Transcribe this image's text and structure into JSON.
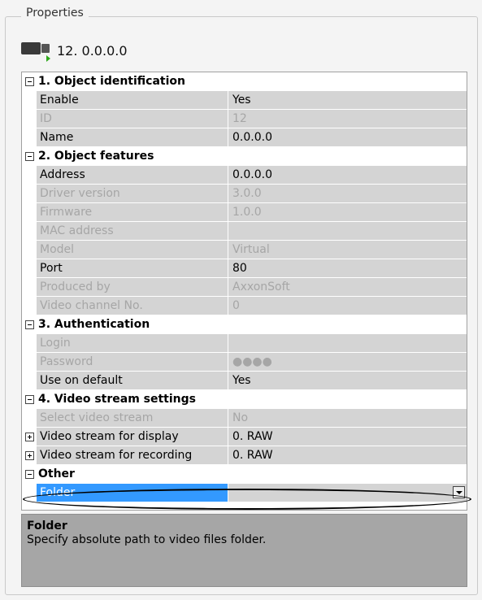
{
  "panel": {
    "legend": "Properties"
  },
  "header": {
    "icon": "camera-icon",
    "title": "12. 0.0.0.0"
  },
  "sections": [
    {
      "title": "1. Object identification",
      "expanded": true,
      "rows": [
        {
          "name": "Enable",
          "value": "Yes",
          "disabled": false
        },
        {
          "name": "ID",
          "value": "12",
          "disabled": true
        },
        {
          "name": "Name",
          "value": "0.0.0.0",
          "disabled": false
        }
      ]
    },
    {
      "title": "2. Object features",
      "expanded": true,
      "rows": [
        {
          "name": "Address",
          "value": "0.0.0.0",
          "disabled": false
        },
        {
          "name": "Driver version",
          "value": "3.0.0",
          "disabled": true
        },
        {
          "name": "Firmware",
          "value": "1.0.0",
          "disabled": true
        },
        {
          "name": "MAC address",
          "value": "",
          "disabled": true
        },
        {
          "name": "Model",
          "value": "Virtual",
          "disabled": true
        },
        {
          "name": "Port",
          "value": "80",
          "disabled": false
        },
        {
          "name": "Produced by",
          "value": "AxxonSoft",
          "disabled": true
        },
        {
          "name": "Video channel No.",
          "value": "0",
          "disabled": true
        }
      ]
    },
    {
      "title": "3. Authentication",
      "expanded": true,
      "rows": [
        {
          "name": "Login",
          "value": "",
          "disabled": true
        },
        {
          "name": "Password",
          "value": "●●●●",
          "disabled": true
        },
        {
          "name": "Use on default",
          "value": "Yes",
          "disabled": false
        }
      ]
    },
    {
      "title": "4. Video stream settings",
      "expanded": true,
      "rows": [
        {
          "name": "Select video stream",
          "value": "No",
          "disabled": true
        },
        {
          "name": "Video stream for display",
          "value": "0. RAW",
          "disabled": false,
          "expandable": true
        },
        {
          "name": "Video stream for recording",
          "value": "0. RAW",
          "disabled": false,
          "expandable": true
        }
      ]
    },
    {
      "title": "Other",
      "expanded": true,
      "rows": [
        {
          "name": "Folder",
          "value": "",
          "disabled": false,
          "selected": true,
          "dropdown": true
        }
      ]
    }
  ],
  "description": {
    "title": "Folder",
    "text": "Specify absolute path to video files folder."
  },
  "colors": {
    "selection": "#3399ff",
    "row_bg": "#d4d4d4",
    "disabled_text": "#a6a6a6",
    "desc_bg": "#a6a6a6"
  }
}
